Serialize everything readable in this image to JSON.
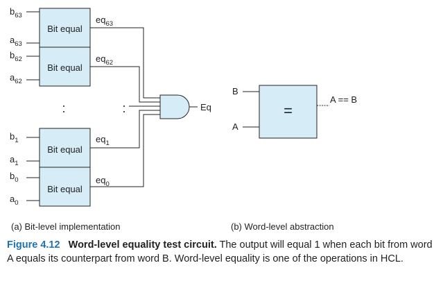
{
  "bit_blocks": [
    {
      "b_base": "b",
      "b_sub": "63",
      "a_base": "a",
      "a_sub": "63",
      "label": "Bit equal",
      "out_base": "eq",
      "out_sub": "63"
    },
    {
      "b_base": "b",
      "b_sub": "62",
      "a_base": "a",
      "a_sub": "62",
      "label": "Bit equal",
      "out_base": "eq",
      "out_sub": "62"
    },
    {
      "b_base": "b",
      "b_sub": "1",
      "a_base": "a",
      "a_sub": "1",
      "label": "Bit equal",
      "out_base": "eq",
      "out_sub": "1"
    },
    {
      "b_base": "b",
      "b_sub": "0",
      "a_base": "a",
      "a_sub": "0",
      "label": "Bit equal",
      "out_base": "eq",
      "out_sub": "0"
    }
  ],
  "ellipsis": ":",
  "and_output": "Eq",
  "word_level": {
    "input_b": "B",
    "input_a": "A",
    "symbol": "=",
    "output": "A == B"
  },
  "subcaptions": {
    "left": "(a) Bit-level implementation",
    "right": "(b) Word-level abstraction"
  },
  "caption": {
    "figure_label": "Figure 4.12",
    "title": "Word-level equality test circuit.",
    "body": "The output will equal 1 when each bit from word A equals its counterpart from word B. Word-level equality is one of the operations in HCL."
  },
  "colors": {
    "box_fill": "#d6ecf7",
    "stroke": "#222222",
    "caption_accent": "#1a72b5"
  }
}
